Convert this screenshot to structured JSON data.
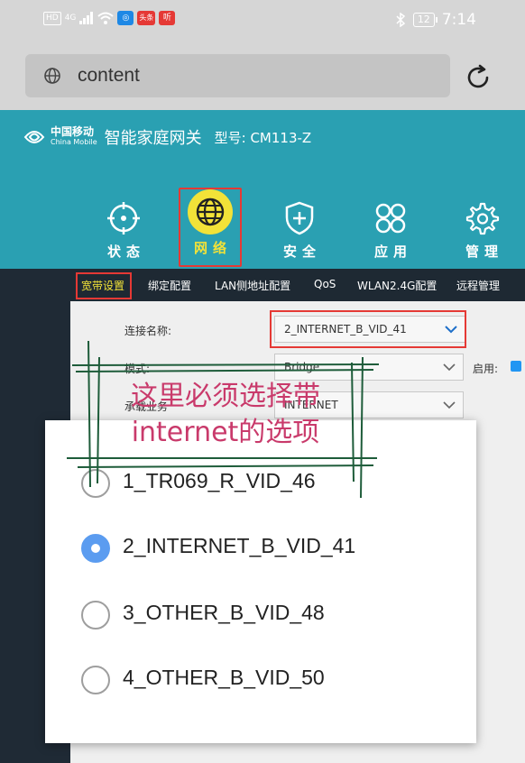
{
  "status_bar": {
    "hd": "HD",
    "network": "4G",
    "app_toutiao": "头条",
    "app_ting": "听",
    "battery": "12",
    "time": "7:14"
  },
  "browser": {
    "url": "content"
  },
  "header": {
    "brand_zh": "中国移动",
    "brand_en": "China Mobile",
    "gateway_name": "智能家庭网关",
    "model": "型号: CM113-Z"
  },
  "nav": {
    "items": [
      {
        "label": "状态",
        "icon": "target-icon"
      },
      {
        "label": "网络",
        "icon": "globe-icon"
      },
      {
        "label": "安全",
        "icon": "shield-plus-icon"
      },
      {
        "label": "应用",
        "icon": "apps-icon"
      },
      {
        "label": "管理",
        "icon": "gear-icon"
      }
    ]
  },
  "subtabs": [
    "宽带设置",
    "绑定配置",
    "LAN侧地址配置",
    "QoS",
    "WLAN2.4G配置",
    "远程管理"
  ],
  "form": {
    "connection_name_label": "连接名称:",
    "connection_name_value": "2_INTERNET_B_VID_41",
    "mode_label": "模式:",
    "mode_value": "Bridge",
    "enable_label": "启用:",
    "service_label": "承载业务",
    "service_value": "INTERNET"
  },
  "dialog": {
    "options": [
      {
        "label": "1_TR069_R_VID_46",
        "selected": false
      },
      {
        "label": "2_INTERNET_B_VID_41",
        "selected": true
      },
      {
        "label": "3_OTHER_B_VID_48",
        "selected": false
      },
      {
        "label": "4_OTHER_B_VID_50",
        "selected": false
      }
    ]
  },
  "annotation": {
    "line1": "这里必须选择带",
    "line2": "internet的选项"
  },
  "colors": {
    "header_teal": "#2aa0b2",
    "highlight_yellow": "#f2e238",
    "annotation_red": "#e53935",
    "annotation_text": "#c93a6b",
    "radio_blue": "#5b9cf0"
  }
}
